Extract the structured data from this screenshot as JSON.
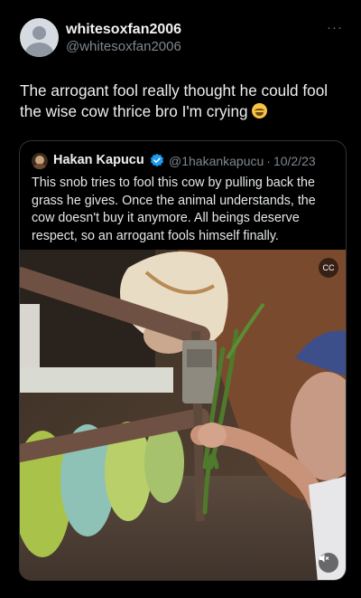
{
  "post": {
    "display_name": "whitesoxfan2006",
    "handle": "@whitesoxfan2006",
    "more_icon": "more-horizontal-icon",
    "text": "The arrogant fool really thought he could fool the wise cow thrice bro I'm crying",
    "emoji": "face-with-tears-of-joy"
  },
  "quote": {
    "display_name": "Hakan Kapucu",
    "verified": true,
    "handle": "@1hakankapucu",
    "separator": "·",
    "date": "10/2/23",
    "text": "This snob tries to fool this cow by pulling back the grass he gives. Once the animal understands, the cow doesn't buy it anymore. All beings deserve respect, so an arrogant fools himself finally.",
    "media": {
      "kind": "video",
      "captions_icon": "captions-icon",
      "captions_label": "CC",
      "mute_icon": "speaker-muted-icon"
    }
  },
  "colors": {
    "background": "#000000",
    "verified_blue": "#1d9bf0",
    "border": "#2f3336",
    "secondary_text": "#7d868e"
  }
}
